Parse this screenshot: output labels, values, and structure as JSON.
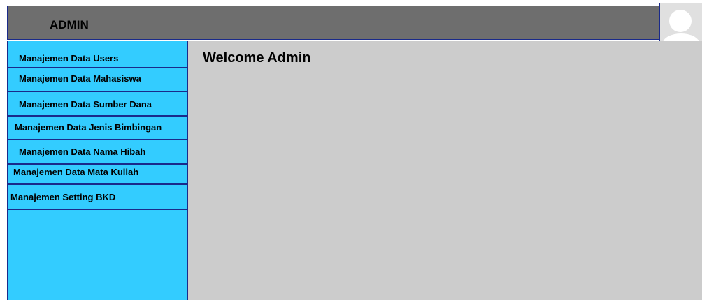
{
  "header": {
    "title": "ADMIN"
  },
  "user": {
    "avatar_icon": "user-avatar-icon"
  },
  "sidebar": {
    "items": [
      {
        "label": "Manajemen Data Users"
      },
      {
        "label": "Manajemen Data Mahasiswa"
      },
      {
        "label": "Manajemen Data Sumber Dana"
      },
      {
        "label": "Manajemen Data Jenis Bimbingan"
      },
      {
        "label": "Manajemen Data Nama Hibah"
      },
      {
        "label": "Manajemen Data Mata Kuliah"
      },
      {
        "label": "Manajemen Setting BKD"
      }
    ]
  },
  "main": {
    "title": "Welcome Admin"
  },
  "colors": {
    "header_bg": "#6e6e6e",
    "sidebar_bg": "#33ccff",
    "content_bg": "#cccccc",
    "border": "#1a2a8a"
  }
}
